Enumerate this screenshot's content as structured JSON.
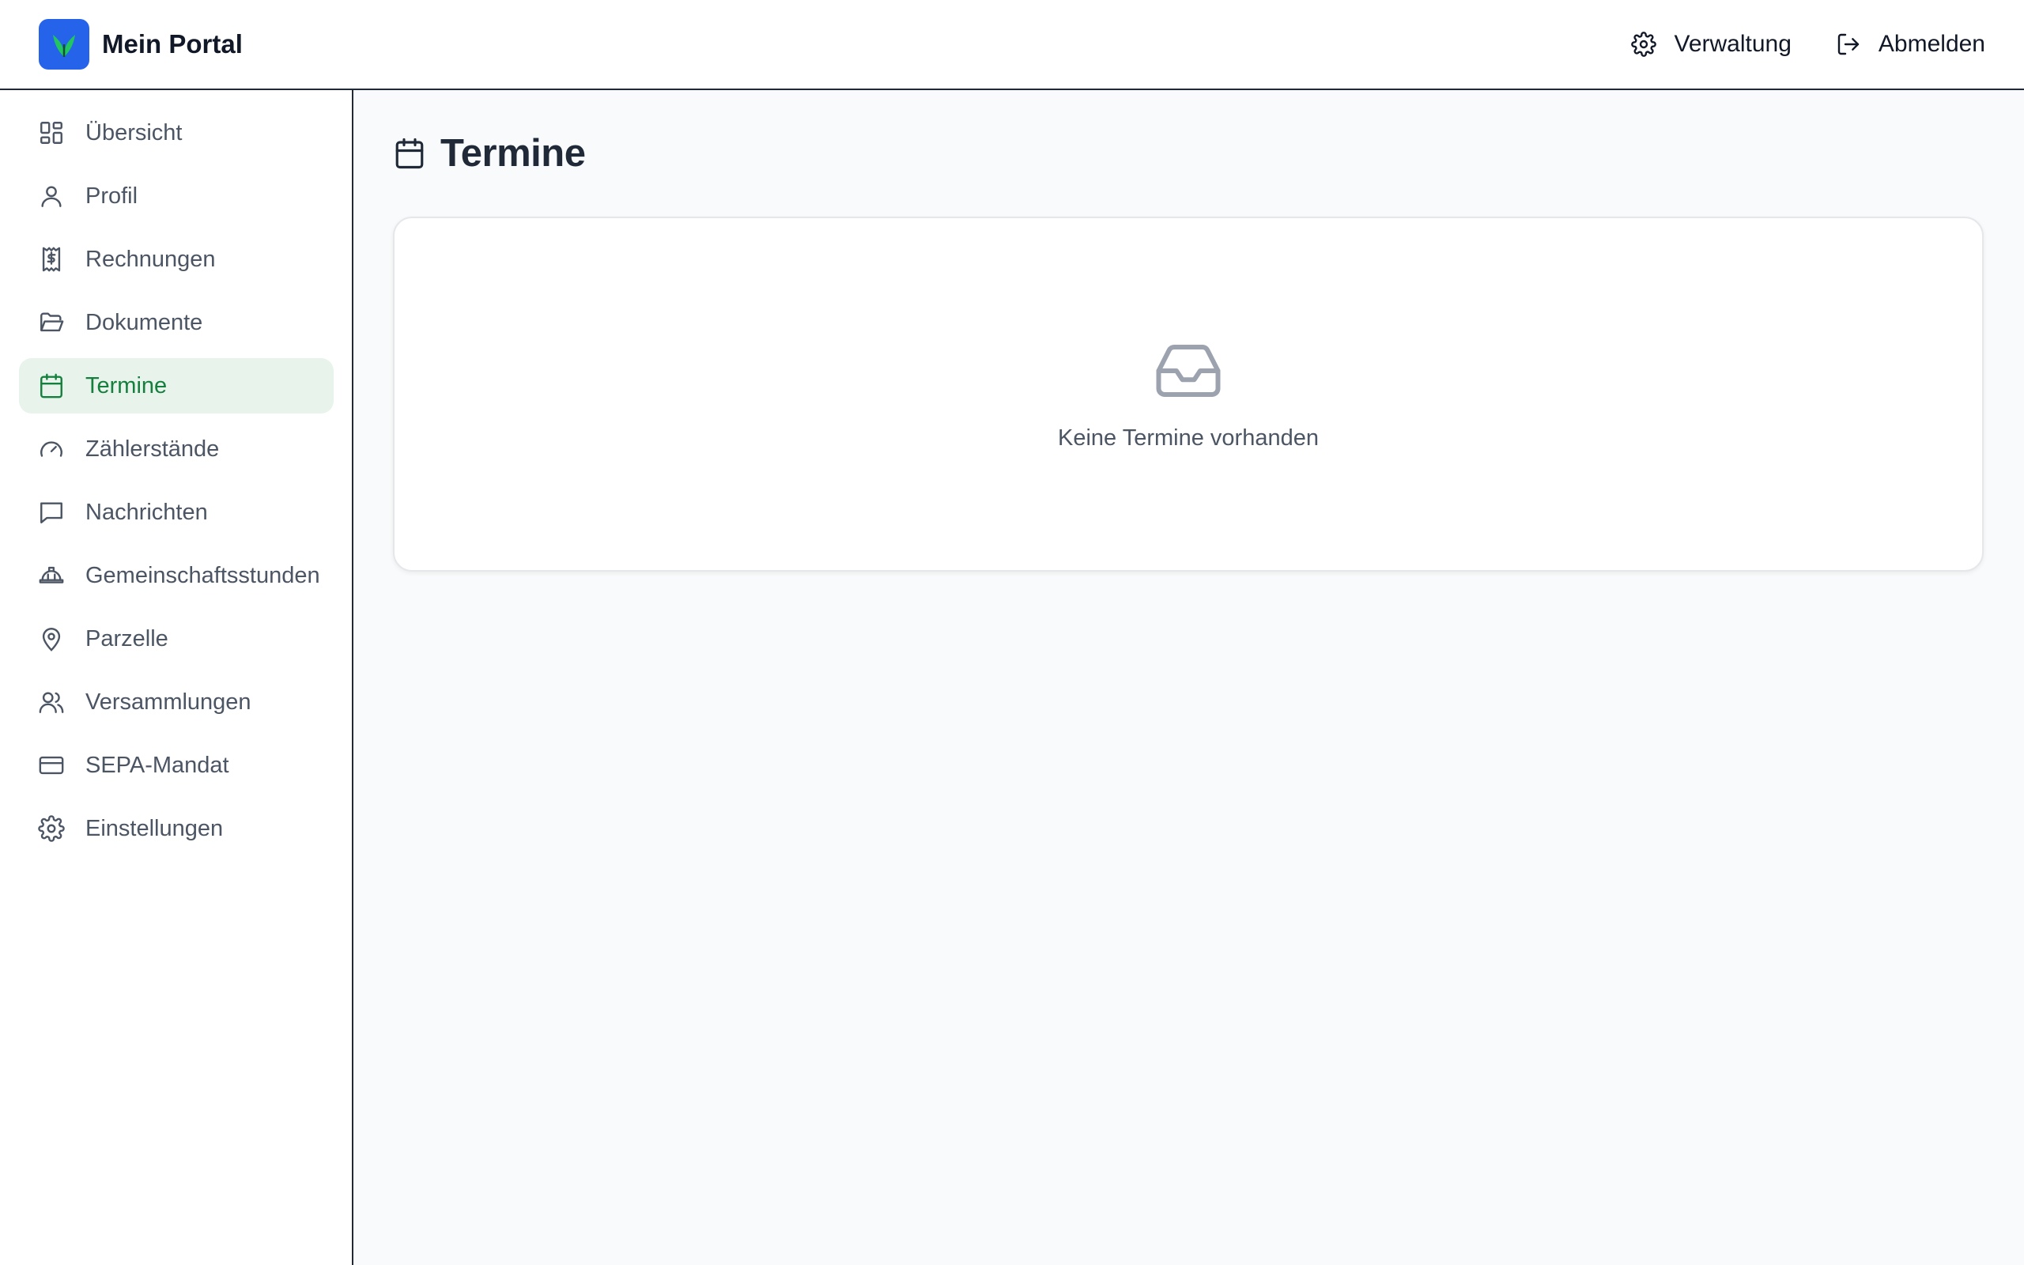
{
  "header": {
    "brand": "Mein Portal",
    "admin_label": "Verwaltung",
    "logout_label": "Abmelden"
  },
  "sidebar": {
    "items": [
      {
        "label": "Übersicht",
        "icon": "grid-icon"
      },
      {
        "label": "Profil",
        "icon": "user-icon"
      },
      {
        "label": "Rechnungen",
        "icon": "receipt-icon"
      },
      {
        "label": "Dokumente",
        "icon": "folder-icon"
      },
      {
        "label": "Termine",
        "icon": "calendar-icon",
        "active": true
      },
      {
        "label": "Zählerstände",
        "icon": "gauge-icon"
      },
      {
        "label": "Nachrichten",
        "icon": "message-icon"
      },
      {
        "label": "Gemeinschaftsstunden",
        "icon": "hardhat-icon"
      },
      {
        "label": "Parzelle",
        "icon": "map-pin-icon"
      },
      {
        "label": "Versammlungen",
        "icon": "users-icon"
      },
      {
        "label": "SEPA-Mandat",
        "icon": "credit-card-icon"
      },
      {
        "label": "Einstellungen",
        "icon": "gear-icon"
      }
    ]
  },
  "main": {
    "title": "Termine",
    "empty_message": "Keine Termine vorhanden"
  },
  "colors": {
    "accent": "#15803d",
    "active_bg": "#e8f3ec",
    "logo_bg": "#2563eb"
  }
}
